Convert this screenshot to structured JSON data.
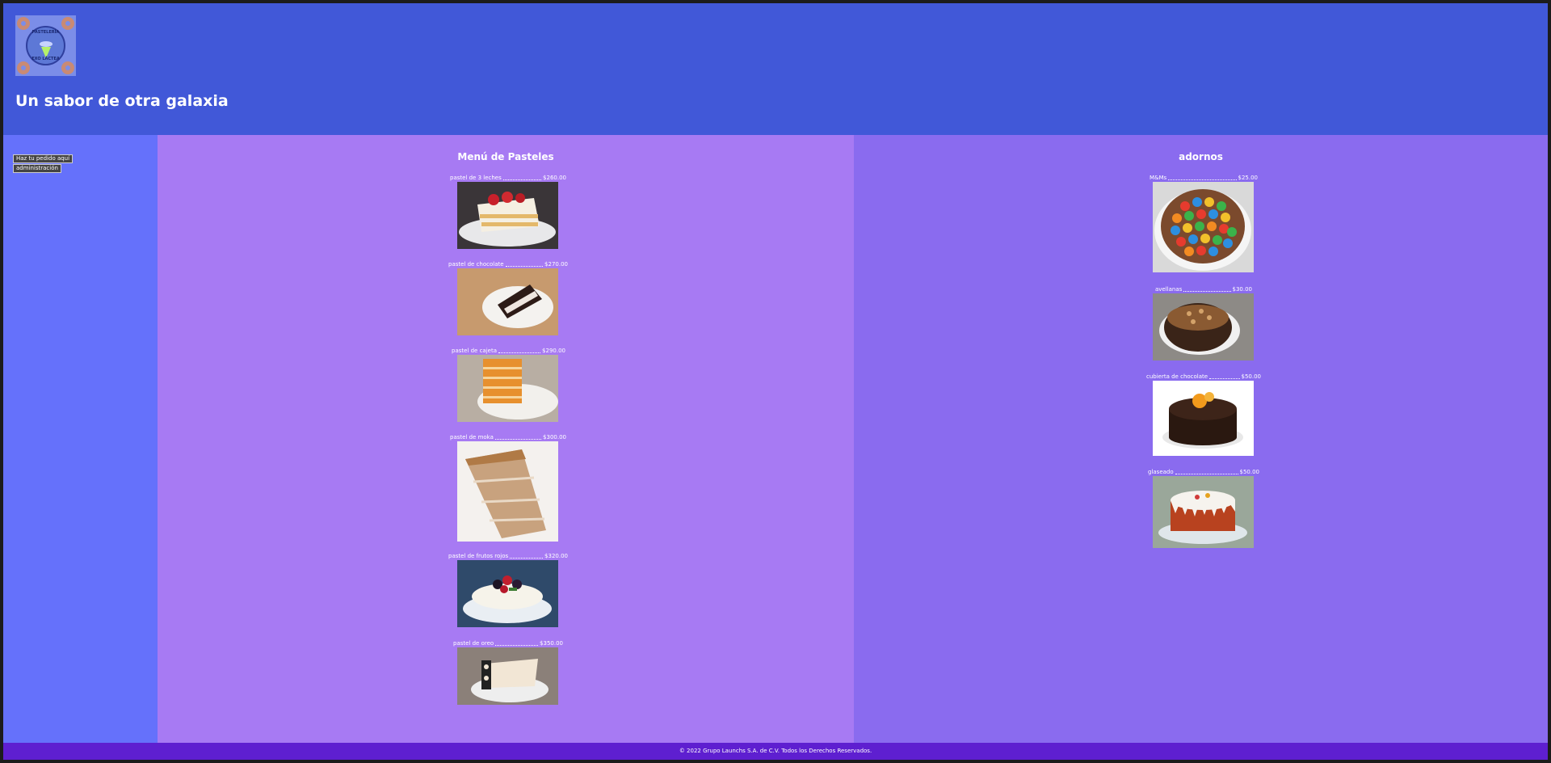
{
  "header": {
    "logo_text_top": "PASTELERÍA",
    "logo_text_bottom": "EXO LÁCTEA",
    "title": "Un sabor de otra galaxia"
  },
  "sidebar": {
    "links": [
      {
        "label": "Haz tu pedido aquí"
      },
      {
        "label": "administración"
      }
    ]
  },
  "menu": {
    "title": "Menú de Pasteles",
    "items": [
      {
        "name": "pastel de 3 leches",
        "price": "$260.00"
      },
      {
        "name": "pastel de chocolate",
        "price": "$270.00"
      },
      {
        "name": "pastel de cajeta",
        "price": "$290.00"
      },
      {
        "name": "pastel de moka",
        "price": "$300.00"
      },
      {
        "name": "pastel de frutos rojos",
        "price": "$320.00"
      },
      {
        "name": "pastel de oreo",
        "price": "$350.00"
      }
    ]
  },
  "adornos": {
    "title": "adornos",
    "items": [
      {
        "name": "M&Ms",
        "price": "$25.00"
      },
      {
        "name": "avellanas",
        "price": "$30.00"
      },
      {
        "name": "cubierta de chocolate",
        "price": "$50.00"
      },
      {
        "name": "glaseado",
        "price": "$50.00"
      }
    ]
  },
  "footer": {
    "text": "© 2022 Grupo Launchs S.A. de C.V. Todos los Derechos Reservados."
  },
  "colors": {
    "header": "#4158d8",
    "sidebar": "#6571fb",
    "menu_column": "#a77af3",
    "adornos_column": "#8a6bef",
    "footer": "#5e1fd0"
  }
}
